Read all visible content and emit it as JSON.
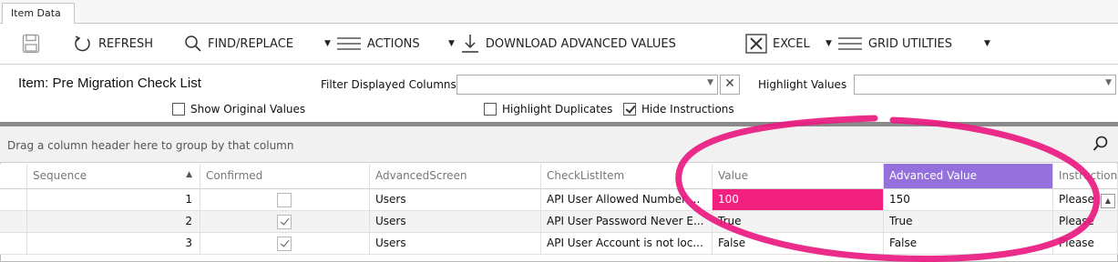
{
  "tab": {
    "label": "Item Data"
  },
  "toolbar": {
    "save_icon": "save-icon",
    "refresh": "REFRESH",
    "find_replace": "FIND/REPLACE",
    "actions": "ACTIONS",
    "download": "DOWNLOAD ADVANCED VALUES",
    "excel": "EXCEL",
    "grid_utilities": "GRID UTILTIES"
  },
  "filter": {
    "item_title": "Item: Pre Migration Check List",
    "filter_columns_label": "Filter Displayed Columns",
    "filter_columns_value": "",
    "highlight_values_label": "Highlight Values",
    "highlight_values_value": "",
    "show_original": {
      "label": "Show Original Values",
      "checked": false
    },
    "highlight_duplicates": {
      "label": "Highlight Duplicates",
      "checked": false
    },
    "hide_instructions": {
      "label": "Hide Instructions",
      "checked": true
    }
  },
  "group_panel": {
    "text": "Drag a column header here to group by that column"
  },
  "grid": {
    "columns": [
      "Sequence",
      "Confirmed",
      "AdvancedScreen",
      "CheckListItem",
      "Value",
      "Advanced Value",
      "Instruction"
    ],
    "sort_indicator": "▲",
    "rows": [
      {
        "sequence": "1",
        "confirmed": false,
        "screen": "Users",
        "item": "API User Allowed Number ...",
        "value": "100",
        "advanced": "150",
        "instruction": "Please"
      },
      {
        "sequence": "2",
        "confirmed": true,
        "screen": "Users",
        "item": "API User Password Never E...",
        "value": "True",
        "advanced": "True",
        "instruction": "Please"
      },
      {
        "sequence": "3",
        "confirmed": true,
        "screen": "Users",
        "item": "API User Account is not loc...",
        "value": "False",
        "advanced": "False",
        "instruction": "Please"
      }
    ]
  },
  "colors": {
    "accent_purple": "#9370db",
    "highlight_pink": "#f2217f"
  }
}
